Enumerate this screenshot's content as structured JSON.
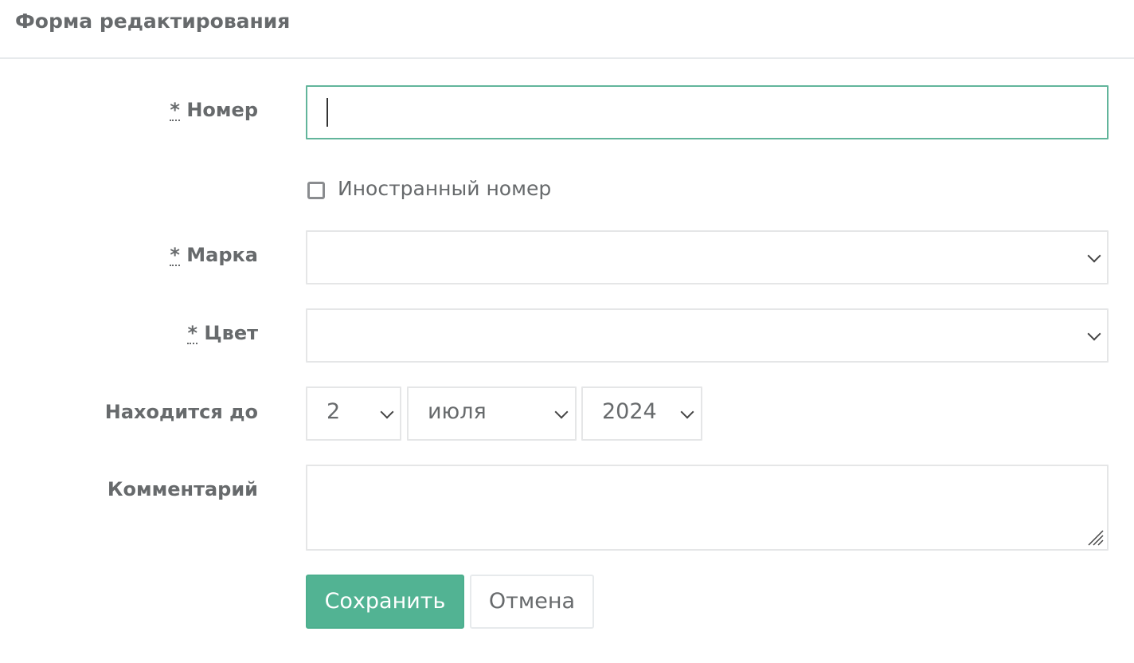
{
  "header": {
    "title": "Форма редактирования"
  },
  "form": {
    "number": {
      "required_mark": "*",
      "label": "Номер",
      "value": ""
    },
    "foreign_number": {
      "label": "Иностранный номер",
      "checked": false
    },
    "brand": {
      "required_mark": "*",
      "label": "Марка",
      "value": ""
    },
    "color": {
      "required_mark": "*",
      "label": "Цвет",
      "value": ""
    },
    "valid_until": {
      "label": "Находится до",
      "day": "2",
      "month": "июля",
      "year": "2024"
    },
    "comment": {
      "label": "Комментарий",
      "value": ""
    }
  },
  "actions": {
    "save_label": "Сохранить",
    "cancel_label": "Отмена"
  },
  "colors": {
    "accent": "#1ab394",
    "text": "#676a6c"
  }
}
